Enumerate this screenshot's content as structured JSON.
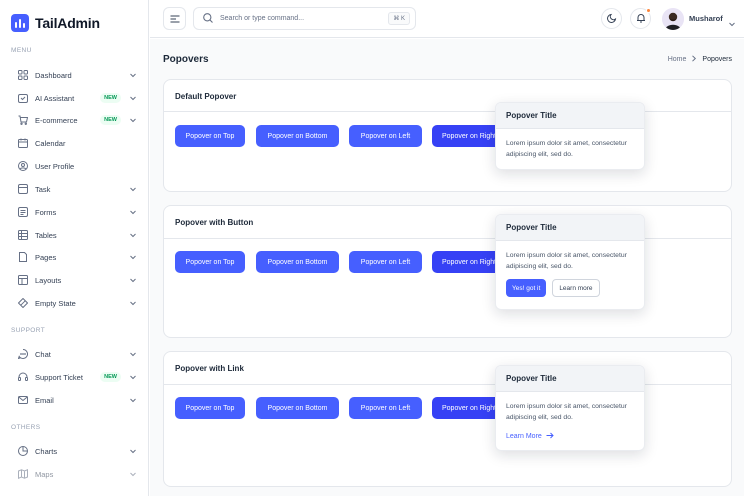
{
  "brand": {
    "name": "TailAdmin",
    "accent": "#465fff"
  },
  "sidebar": {
    "menu_label": "MENU",
    "support_label": "SUPPORT",
    "others_label": "OTHERS",
    "items": [
      {
        "label": "Dashboard",
        "icon": "grid-icon",
        "chevron": true
      },
      {
        "label": "AI Assistant",
        "icon": "ai-icon",
        "badge": "NEW",
        "chevron": true
      },
      {
        "label": "E-commerce",
        "icon": "cart-icon",
        "badge": "NEW",
        "chevron": true
      },
      {
        "label": "Calendar",
        "icon": "calendar-icon"
      },
      {
        "label": "User Profile",
        "icon": "user-icon"
      },
      {
        "label": "Task",
        "icon": "task-icon",
        "chevron": true
      },
      {
        "label": "Forms",
        "icon": "form-icon",
        "chevron": true
      },
      {
        "label": "Tables",
        "icon": "table-icon",
        "chevron": true
      },
      {
        "label": "Pages",
        "icon": "page-icon",
        "chevron": true
      },
      {
        "label": "Layouts",
        "icon": "layout-icon",
        "chevron": true
      },
      {
        "label": "Empty State",
        "icon": "empty-state-icon",
        "chevron": true
      }
    ],
    "support_items": [
      {
        "label": "Chat",
        "icon": "chat-icon",
        "chevron": true
      },
      {
        "label": "Support Ticket",
        "icon": "headset-icon",
        "badge": "NEW",
        "chevron": true
      },
      {
        "label": "Email",
        "icon": "mail-icon",
        "chevron": true
      }
    ],
    "other_items": [
      {
        "label": "Charts",
        "icon": "pie-chart-icon",
        "chevron": true
      },
      {
        "label": "Maps",
        "icon": "map-icon",
        "chevron": true
      }
    ]
  },
  "header": {
    "search_placeholder": "Search or type command...",
    "search_shortcut": "⌘ K",
    "username": "Musharof"
  },
  "page": {
    "title": "Popovers",
    "breadcrumb_home": "Home",
    "breadcrumb_current": "Popovers"
  },
  "cards": [
    {
      "title": "Default Popover",
      "buttons": [
        "Popover on Top",
        "Popover on Bottom",
        "Popover on Left",
        "Popover on Right"
      ],
      "popover": {
        "title": "Popover Title",
        "body": "Lorem ipsum dolor sit amet, consectetur adipiscing elit, sed do."
      }
    },
    {
      "title": "Popover with Button",
      "buttons": [
        "Popover on Top",
        "Popover on Bottom",
        "Popover on Left",
        "Popover on Right"
      ],
      "popover": {
        "title": "Popover Title",
        "body": "Lorem ipsum dolor sit amet, consectetur adipiscing elit, sed do.",
        "primary": "Yes! got it",
        "secondary": "Learn more"
      }
    },
    {
      "title": "Popover with Link",
      "buttons": [
        "Popover on Top",
        "Popover on Bottom",
        "Popover on Left",
        "Popover on Right"
      ],
      "popover": {
        "title": "Popover Title",
        "body": "Lorem ipsum dolor sit amet, consectetur adipiscing elit, sed do.",
        "link": "Learn More"
      }
    }
  ]
}
